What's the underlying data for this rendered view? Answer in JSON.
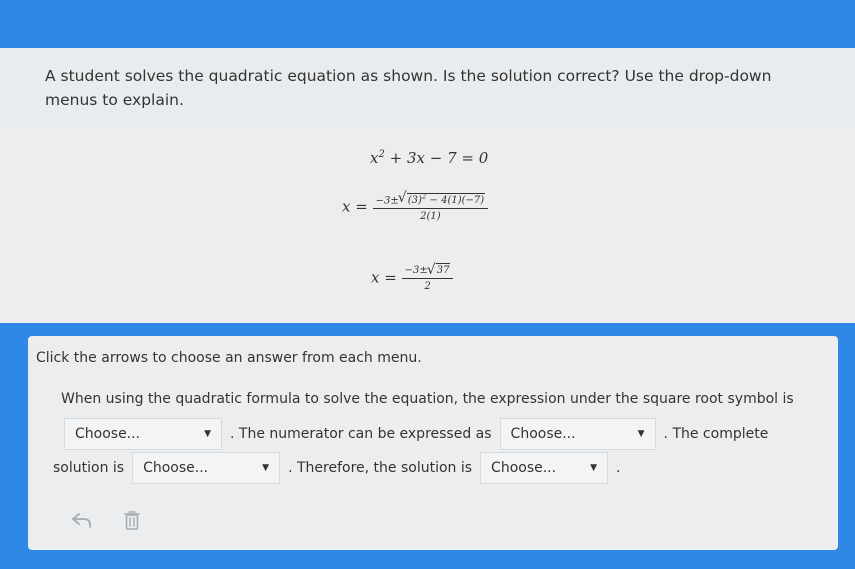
{
  "question": {
    "text": "A student solves the quadratic equation as shown. Is the solution correct? Use the drop-down menus to explain."
  },
  "math": {
    "line1": {
      "lhs": "x",
      "sup": "2",
      "rhs": "+ 3x − 7 = 0"
    },
    "line2": {
      "lhs": "x =",
      "pre": "−3±",
      "radicand": "(3)",
      "rad_sup": "2",
      "radicand_rest": " − 4(1)(−7)",
      "den": "2(1)"
    },
    "line3": {
      "lhs": "x =",
      "pre": "−3±",
      "radicand": "37",
      "den": "2"
    }
  },
  "answer": {
    "instruction": "Click the arrows to choose an answer from each menu.",
    "sentence1": "When using the quadratic formula to solve the equation, the expression under the square root symbol is",
    "dropdown1": "Choose...",
    "text2": ". The numerator can be expressed as",
    "dropdown2": "Choose...",
    "text3": ". The complete",
    "text4": "solution is",
    "dropdown3": "Choose...",
    "text5": ". Therefore, the solution is",
    "dropdown4": "Choose...",
    "text6": "."
  },
  "tools": {
    "undo_icon": "undo-arrow",
    "delete_icon": "trash-can"
  },
  "colors": {
    "frame_blue": "#2f87e6",
    "panel_bg": "#ecedef",
    "dropdown_bg": "#f3f4f5",
    "tool_gray": "#a5abb2"
  }
}
